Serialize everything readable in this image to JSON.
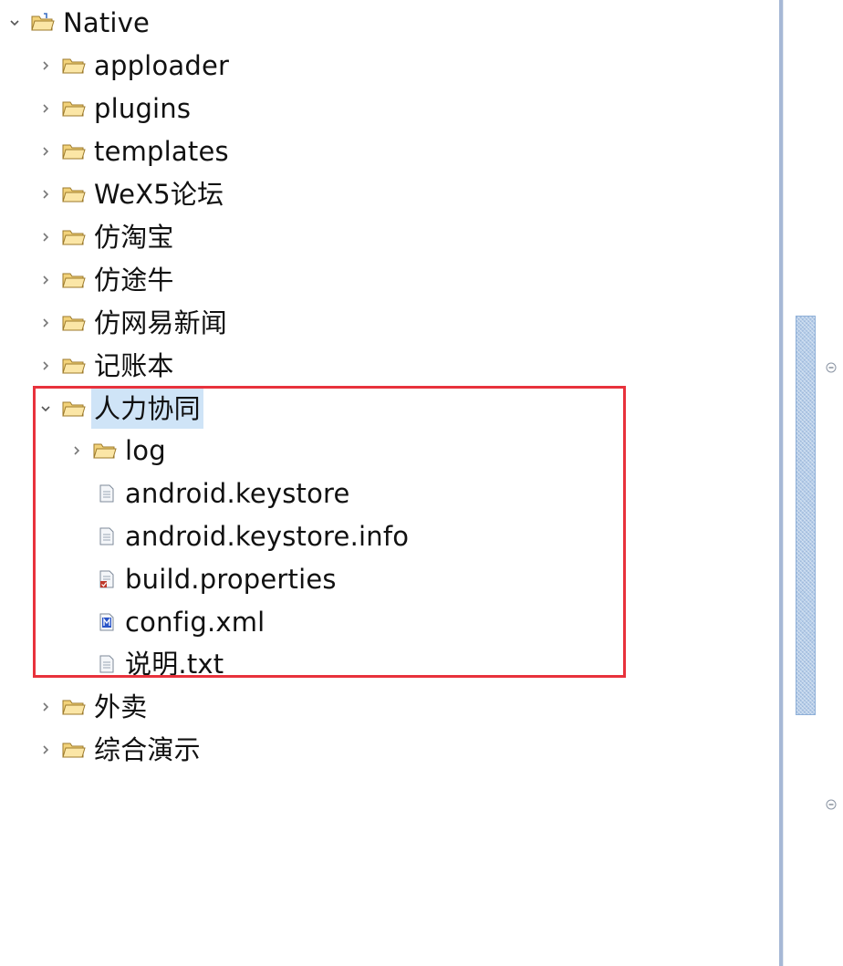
{
  "tree": {
    "rows": [
      {
        "label": "Native",
        "expanded": true,
        "icon": "project-folder-icon"
      },
      {
        "label": "apploader",
        "expanded": false,
        "icon": "folder-icon"
      },
      {
        "label": "plugins",
        "expanded": false,
        "icon": "folder-icon"
      },
      {
        "label": "templates",
        "expanded": false,
        "icon": "folder-icon"
      },
      {
        "label": "WeX5论坛",
        "expanded": false,
        "icon": "folder-icon"
      },
      {
        "label": "仿淘宝",
        "expanded": false,
        "icon": "folder-icon"
      },
      {
        "label": "仿途牛",
        "expanded": false,
        "icon": "folder-icon"
      },
      {
        "label": "仿网易新闻",
        "expanded": false,
        "icon": "folder-icon"
      },
      {
        "label": "记账本",
        "expanded": false,
        "icon": "folder-icon"
      },
      {
        "label": "人力协同",
        "expanded": true,
        "selected": true,
        "icon": "folder-icon"
      },
      {
        "label": "log",
        "expanded": false,
        "icon": "folder-icon"
      },
      {
        "label": "android.keystore",
        "icon": "text-file-icon"
      },
      {
        "label": "android.keystore.info",
        "icon": "text-file-icon"
      },
      {
        "label": "build.properties",
        "icon": "properties-file-icon"
      },
      {
        "label": "config.xml",
        "icon": "xml-file-icon"
      },
      {
        "label": "说明.txt",
        "icon": "text-file-icon"
      },
      {
        "label": "外卖",
        "expanded": false,
        "icon": "folder-icon"
      },
      {
        "label": "综合演示",
        "expanded": false,
        "icon": "folder-icon"
      }
    ]
  },
  "colors": {
    "selection": "#cfe4f7",
    "highlight_box": "#e8323c",
    "folder": "#f2d27a",
    "scroll_thumb": "#b5cde9"
  }
}
